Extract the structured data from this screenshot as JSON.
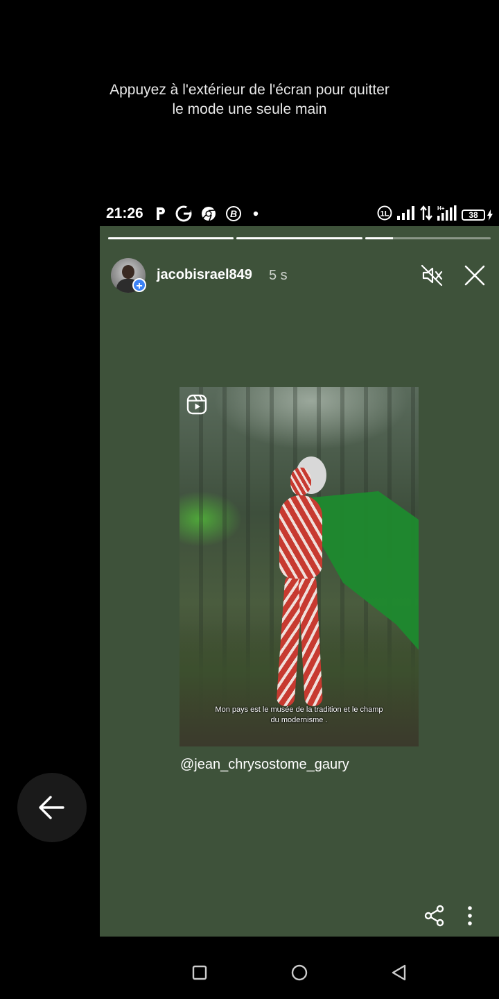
{
  "one_hand_hint": {
    "line1": "Appuyez à l'extérieur de l'écran pour quitter",
    "line2": "le mode une seule main"
  },
  "status_bar": {
    "time": "21:26",
    "left_icons": [
      "parking-icon",
      "google-icon",
      "chrome-icon",
      "bitcoin-icon",
      "dot-icon"
    ],
    "right_icons": [
      "sim-icon",
      "signal-icon",
      "data-arrows-icon",
      "hplus-signal-icon",
      "battery-icon"
    ],
    "battery": "38"
  },
  "story": {
    "background_color": "#3e523a",
    "progress": [
      1.0,
      1.0,
      0.22
    ],
    "username": "jacobisrael849",
    "time_ago": "5 s",
    "post": {
      "subtitle_line1": "Mon pays est le musée de la tradition et le champ",
      "subtitle_line2": "du modernisme ."
    },
    "mention": "@jean_chrysostome_gaury",
    "actions": [
      "mute-icon",
      "close-icon",
      "share-icon",
      "more-icon"
    ]
  },
  "navigation": [
    "recents-button",
    "home-button",
    "back-button"
  ]
}
